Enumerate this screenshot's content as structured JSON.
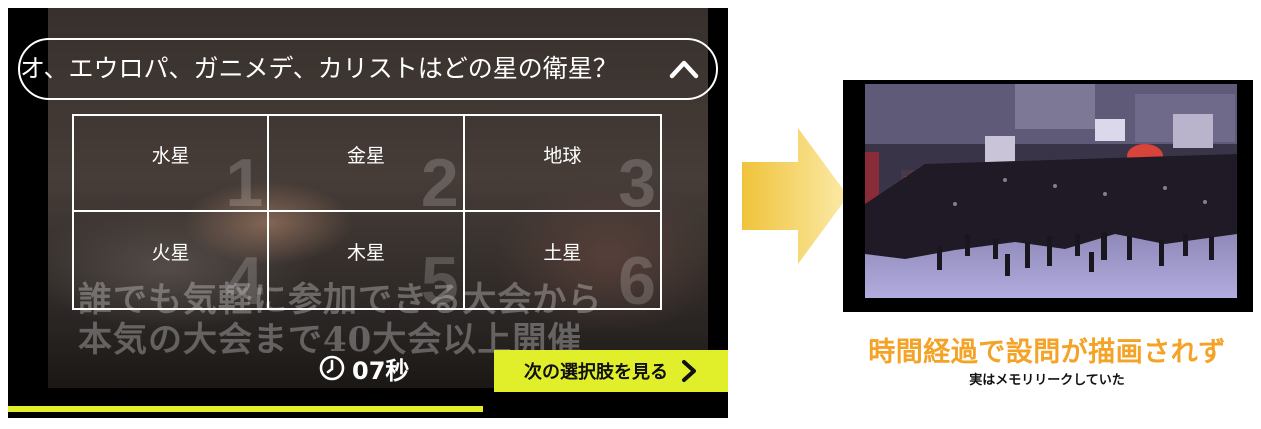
{
  "quiz": {
    "question": "オ、エウロパ、ガニメデ、カリストはどの星の衛星？",
    "answers": [
      {
        "label": "水星",
        "number": "1"
      },
      {
        "label": "金星",
        "number": "2"
      },
      {
        "label": "地球",
        "number": "3"
      },
      {
        "label": "火星",
        "number": "4"
      },
      {
        "label": "木星",
        "number": "5"
      },
      {
        "label": "土星",
        "number": "6"
      }
    ],
    "timer": "07秒",
    "next_button": "次の選択肢を見る",
    "progress_percent": 66,
    "background_caption": [
      "誰でも気軽に参加できる大会から",
      "本気の大会まで40大会以上開催"
    ]
  },
  "result": {
    "title": "時間経過で設問が描画されず",
    "subtitle": "実はメモリリークしていた"
  },
  "colors": {
    "accent_yellow": "#e0ef2a",
    "caption_orange": "#f4a326",
    "arrow_gradient": [
      "#f0c33a",
      "#fbeaa8"
    ]
  },
  "icons": [
    "chevron-up-icon",
    "clock-icon",
    "chevron-right-icon",
    "arrow-right-icon"
  ]
}
